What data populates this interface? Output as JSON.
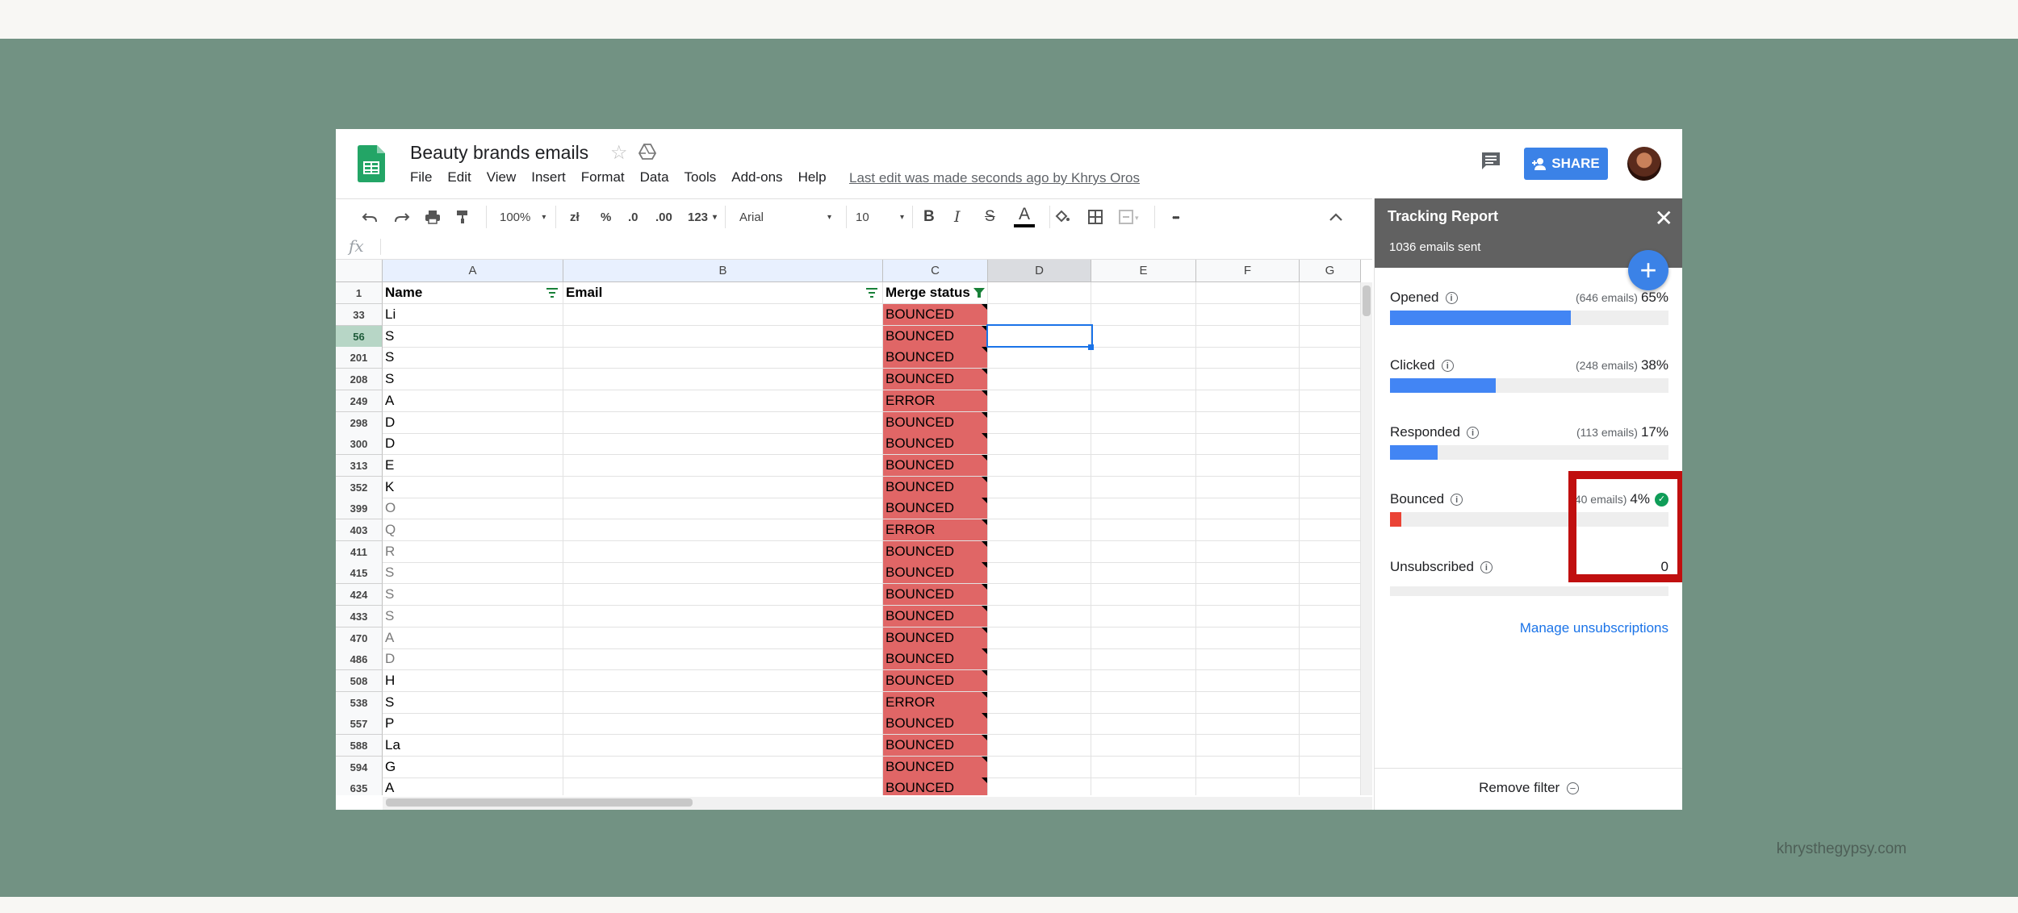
{
  "app": {
    "doc_title": "Beauty brands emails",
    "menu": [
      "File",
      "Edit",
      "View",
      "Insert",
      "Format",
      "Data",
      "Tools",
      "Add-ons",
      "Help"
    ],
    "last_edit": "Last edit was made seconds ago by Khrys Oros",
    "share_label": "SHARE",
    "fx_label": "fx"
  },
  "toolbar": {
    "zoom": "100%",
    "currency": "zł",
    "percent": "%",
    "dec_decrease": ".0",
    "dec_increase": ".00",
    "more_formats": "123",
    "font": "Arial",
    "font_size": "10",
    "bold": "B",
    "italic": "I",
    "strike": "S",
    "text_color": "A",
    "more": "•••"
  },
  "grid": {
    "columns": [
      "A",
      "B",
      "C",
      "D",
      "E",
      "F",
      "G"
    ],
    "header_row": {
      "num": "1",
      "name": "Name",
      "email": "Email",
      "status": "Merge status"
    },
    "rows": [
      {
        "num": "33",
        "name": "Li",
        "status": "BOUNCED"
      },
      {
        "num": "56",
        "name": "S",
        "status": "BOUNCED"
      },
      {
        "num": "201",
        "name": "S",
        "status": "BOUNCED"
      },
      {
        "num": "208",
        "name": "S",
        "status": "BOUNCED"
      },
      {
        "num": "249",
        "name": "A",
        "status": "ERROR"
      },
      {
        "num": "298",
        "name": "D",
        "status": "BOUNCED"
      },
      {
        "num": "300",
        "name": "D",
        "status": "BOUNCED"
      },
      {
        "num": "313",
        "name": "E",
        "status": "BOUNCED"
      },
      {
        "num": "352",
        "name": "K",
        "status": "BOUNCED"
      },
      {
        "num": "399",
        "name": "O",
        "status": "BOUNCED"
      },
      {
        "num": "403",
        "name": "Q",
        "status": "ERROR"
      },
      {
        "num": "411",
        "name": "R",
        "status": "BOUNCED"
      },
      {
        "num": "415",
        "name": "S",
        "status": "BOUNCED"
      },
      {
        "num": "424",
        "name": "S",
        "status": "BOUNCED"
      },
      {
        "num": "433",
        "name": "S",
        "status": "BOUNCED"
      },
      {
        "num": "470",
        "name": "A",
        "status": "BOUNCED"
      },
      {
        "num": "486",
        "name": "D",
        "status": "BOUNCED"
      },
      {
        "num": "508",
        "name": "H",
        "status": "BOUNCED"
      },
      {
        "num": "538",
        "name": "S",
        "status": "ERROR"
      },
      {
        "num": "557",
        "name": "P",
        "status": "BOUNCED"
      },
      {
        "num": "588",
        "name": "La",
        "status": "BOUNCED"
      },
      {
        "num": "594",
        "name": "G",
        "status": "BOUNCED"
      },
      {
        "num": "635",
        "name": "A",
        "status": "BOUNCED"
      }
    ],
    "active_row": "56",
    "status_color": "#e06666"
  },
  "panel": {
    "title": "Tracking Report",
    "subtitle": "1036 emails sent",
    "close": "✕",
    "add": "+",
    "metrics": [
      {
        "label": "Opened",
        "count": "(646 emails)",
        "pct": "65%",
        "value": 0.65,
        "color": "#4285f4"
      },
      {
        "label": "Clicked",
        "count": "(248 emails)",
        "pct": "38%",
        "value": 0.38,
        "color": "#4285f4"
      },
      {
        "label": "Responded",
        "count": "(113 emails)",
        "pct": "17%",
        "value": 0.17,
        "color": "#4285f4"
      },
      {
        "label": "Bounced",
        "count": "(40 emails)",
        "pct": "4%",
        "value": 0.04,
        "color": "#ea4335"
      },
      {
        "label": "Unsubscribed",
        "count": "",
        "pct": "0",
        "value": 0,
        "color": "#4285f4"
      }
    ],
    "manage_link": "Manage unsubscriptions",
    "remove_filter": "Remove filter"
  },
  "watermark": "khrysthegypsy.com"
}
